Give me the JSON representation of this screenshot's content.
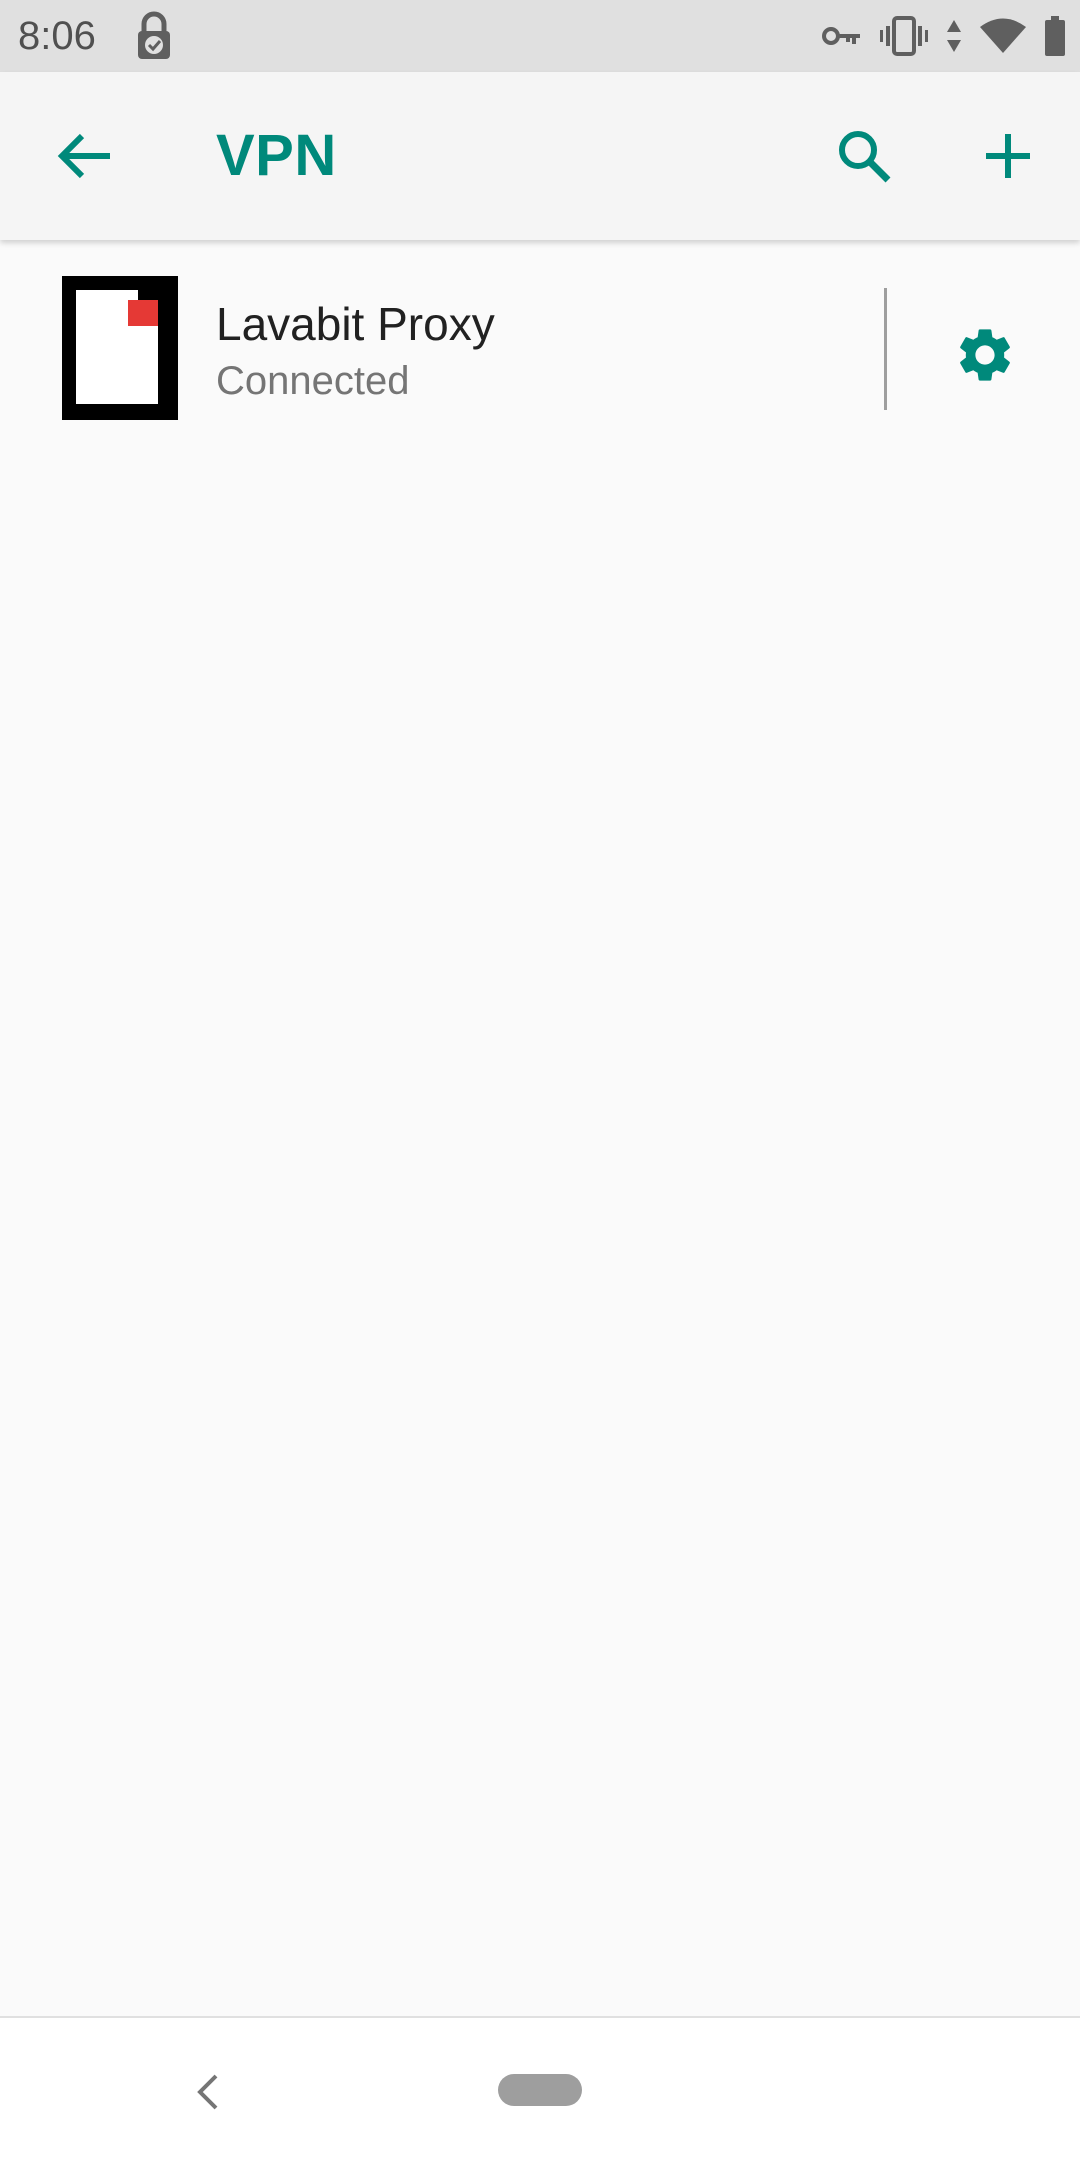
{
  "status_bar": {
    "time": "8:06",
    "icons": [
      "lock-check-icon",
      "vpn-key-icon",
      "vibrate-icon",
      "data-arrows-icon",
      "wifi-icon",
      "battery-icon"
    ]
  },
  "app_bar": {
    "back_icon": "arrow-back-icon",
    "title": "VPN",
    "actions": [
      "search-icon",
      "add-icon"
    ]
  },
  "vpn_list": [
    {
      "name": "Lavabit Proxy",
      "status": "Connected",
      "icon": "lavabit-app-icon",
      "settings_icon": "gear-icon"
    }
  ],
  "nav_bar": {
    "back_icon": "chevron-left-icon",
    "home_icon": "home-pill-icon"
  },
  "colors": {
    "accent": "#00897B",
    "status_bar_bg": "#E0E0E0",
    "app_bar_bg": "#F5F5F5",
    "background": "#FAFAFA",
    "lavabit_red": "#E53935"
  }
}
